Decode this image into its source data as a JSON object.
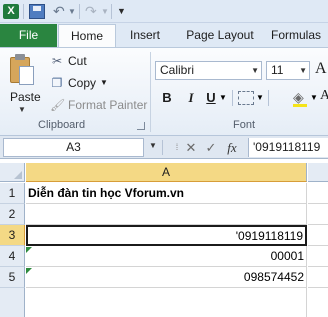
{
  "title_bar": {
    "app_icon": "excel-logo-icon",
    "save": "save-icon",
    "undo": "undo-icon",
    "redo": "redo-icon",
    "customize": "customize-qat-icon",
    "logo_glyph": "X"
  },
  "tabs": [
    {
      "label": "File",
      "active": false
    },
    {
      "label": "Home",
      "active": true
    },
    {
      "label": "Insert",
      "active": false
    },
    {
      "label": "Page Layout",
      "active": false
    },
    {
      "label": "Formulas",
      "active": false
    }
  ],
  "clipboard": {
    "paste_label": "Paste",
    "cut_label": "Cut",
    "copy_label": "Copy",
    "format_painter_label": "Format Painter",
    "group_label": "Clipboard"
  },
  "font": {
    "font_name": "Calibri",
    "font_size": "11",
    "grow_font": "A",
    "bold": "B",
    "italic": "I",
    "underline": "U",
    "group_label": "Font"
  },
  "formula_bar": {
    "name_box": "A3",
    "cancel": "✕",
    "enter": "✓",
    "fx": "fx",
    "content": "'0919118119"
  },
  "sheet": {
    "column_header": "A",
    "selected_cell": "A3",
    "rows": [
      {
        "row": "1",
        "value": "Diễn đàn tin học Vforum.vn",
        "bold": true,
        "align": "left"
      },
      {
        "row": "2",
        "value": "",
        "bold": false,
        "align": "left"
      },
      {
        "row": "3",
        "value": "'0919118119",
        "bold": false,
        "align": "right"
      },
      {
        "row": "4",
        "value": "00001",
        "bold": false,
        "align": "right"
      },
      {
        "row": "5",
        "value": "098574452",
        "bold": false,
        "align": "right"
      }
    ]
  },
  "colors": {
    "file_tab": "#2a8540",
    "selection_header": "#f4d985",
    "error_flag": "#2d8a3d"
  }
}
